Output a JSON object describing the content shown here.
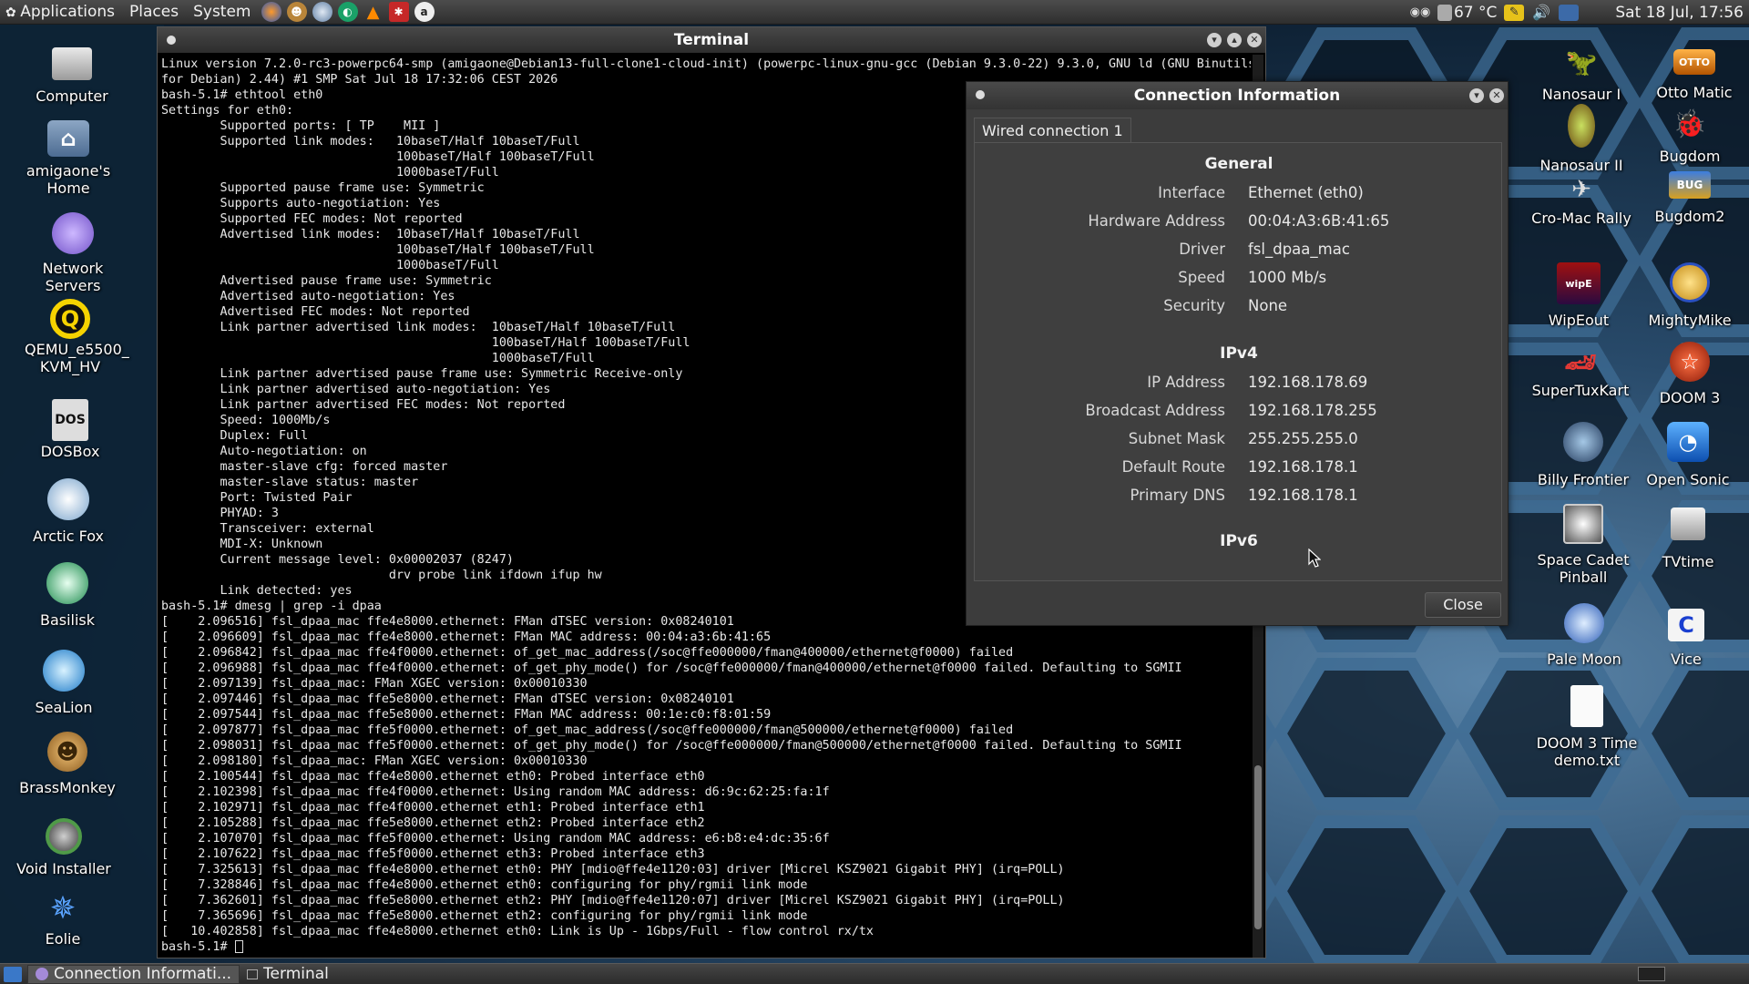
{
  "top_panel": {
    "menus": [
      "Applications",
      "Places",
      "System"
    ],
    "launchers": [
      "firefox-icon",
      "monkey-icon",
      "globe-icon",
      "app-icon",
      "vlc-icon",
      "tool-icon",
      "circle-a-icon"
    ],
    "temperature": "67 °C",
    "clock": "Sat 18 Jul, 17:56"
  },
  "desktop_left": [
    {
      "label": "Computer",
      "icon": "computer-icon"
    },
    {
      "label": "amigaone's Home",
      "icon": "home-folder-icon"
    },
    {
      "label": "Network Servers",
      "icon": "network-icon"
    },
    {
      "label": "QEMU_e5500_ KVM_HV",
      "icon": "qemu-icon"
    },
    {
      "label": "DOSBox",
      "icon": "dosbox-icon"
    },
    {
      "label": "Arctic Fox",
      "icon": "arctic-fox-icon"
    },
    {
      "label": "Basilisk",
      "icon": "basilisk-icon"
    },
    {
      "label": "SeaLion",
      "icon": "sealion-icon"
    },
    {
      "label": "BrassMonkey",
      "icon": "brassmonkey-icon"
    },
    {
      "label": "Void Installer",
      "icon": "void-icon"
    },
    {
      "label": "Eolie",
      "icon": "eolie-icon"
    }
  ],
  "desktop_right": [
    {
      "label": "Nanosaur I",
      "icon": "nanosaur-icon"
    },
    {
      "label": "Otto Matic",
      "icon": "otto-matic-icon"
    },
    {
      "label": "Nanosaur II",
      "icon": "nanosaur2-icon"
    },
    {
      "label": "Bugdom",
      "icon": "bugdom-icon"
    },
    {
      "label": "Cro-Mac Rally",
      "icon": "cromac-icon"
    },
    {
      "label": "Bugdom2",
      "icon": "bugdom2-icon"
    },
    {
      "label": "WipEout",
      "icon": "wipeout-icon"
    },
    {
      "label": "MightyMike",
      "icon": "mightymike-icon"
    },
    {
      "label": "SuperTuxKart",
      "icon": "supertuxkart-icon"
    },
    {
      "label": "DOOM 3",
      "icon": "doom3-icon"
    },
    {
      "label": "Billy Frontier",
      "icon": "billy-frontier-icon"
    },
    {
      "label": "Open Sonic",
      "icon": "open-sonic-icon"
    },
    {
      "label": "Space Cadet Pinball",
      "icon": "pinball-icon"
    },
    {
      "label": "TVtime",
      "icon": "tvtime-icon"
    },
    {
      "label": "Pale Moon",
      "icon": "palemoon-icon"
    },
    {
      "label": "Vice",
      "icon": "vice-icon"
    },
    {
      "label": "DOOM 3 Time demo.txt",
      "icon": "text-file-icon"
    }
  ],
  "terminal": {
    "title": "Terminal",
    "lines": [
      "Linux version 7.2.0-rc3-powerpc64-smp (amigaone@Debian13-full-clone1-cloud-init) (powerpc-linux-gnu-gcc (Debian 9.3.0-22) 9.3.0, GNU ld (GNU Binutils",
      "for Debian) 2.44) #1 SMP Sat Jul 18 17:32:06 CEST 2026",
      "bash-5.1# ethtool eth0",
      "Settings for eth0:",
      "        Supported ports: [ TP    MII ]",
      "        Supported link modes:   10baseT/Half 10baseT/Full",
      "                                100baseT/Half 100baseT/Full",
      "                                1000baseT/Full",
      "        Supported pause frame use: Symmetric",
      "        Supports auto-negotiation: Yes",
      "        Supported FEC modes: Not reported",
      "        Advertised link modes:  10baseT/Half 10baseT/Full",
      "                                100baseT/Half 100baseT/Full",
      "                                1000baseT/Full",
      "        Advertised pause frame use: Symmetric",
      "        Advertised auto-negotiation: Yes",
      "        Advertised FEC modes: Not reported",
      "        Link partner advertised link modes:  10baseT/Half 10baseT/Full",
      "                                             100baseT/Half 100baseT/Full",
      "                                             1000baseT/Full",
      "        Link partner advertised pause frame use: Symmetric Receive-only",
      "        Link partner advertised auto-negotiation: Yes",
      "        Link partner advertised FEC modes: Not reported",
      "        Speed: 1000Mb/s",
      "        Duplex: Full",
      "        Auto-negotiation: on",
      "        master-slave cfg: forced master",
      "        master-slave status: master",
      "        Port: Twisted Pair",
      "        PHYAD: 3",
      "        Transceiver: external",
      "        MDI-X: Unknown",
      "        Current message level: 0x00002037 (8247)",
      "                               drv probe link ifdown ifup hw",
      "        Link detected: yes",
      "bash-5.1# dmesg | grep -i dpaa",
      "[    2.096516] fsl_dpaa_mac ffe4e8000.ethernet: FMan dTSEC version: 0x08240101",
      "[    2.096609] fsl_dpaa_mac ffe4e8000.ethernet: FMan MAC address: 00:04:a3:6b:41:65",
      "[    2.096842] fsl_dpaa_mac ffe4f0000.ethernet: of_get_mac_address(/soc@ffe000000/fman@400000/ethernet@f0000) failed",
      "[    2.096988] fsl_dpaa_mac ffe4f0000.ethernet: of_get_phy_mode() for /soc@ffe000000/fman@400000/ethernet@f0000 failed. Defaulting to SGMII",
      "[    2.097139] fsl_dpaa_mac: FMan XGEC version: 0x00010330",
      "[    2.097446] fsl_dpaa_mac ffe5e8000.ethernet: FMan dTSEC version: 0x08240101",
      "[    2.097544] fsl_dpaa_mac ffe5e8000.ethernet: FMan MAC address: 00:1e:c0:f8:01:59",
      "[    2.097877] fsl_dpaa_mac ffe5f0000.ethernet: of_get_mac_address(/soc@ffe000000/fman@500000/ethernet@f0000) failed",
      "[    2.098031] fsl_dpaa_mac ffe5f0000.ethernet: of_get_phy_mode() for /soc@ffe000000/fman@500000/ethernet@f0000 failed. Defaulting to SGMII",
      "[    2.098180] fsl_dpaa_mac: FMan XGEC version: 0x00010330",
      "[    2.100544] fsl_dpaa_mac ffe4e8000.ethernet eth0: Probed interface eth0",
      "[    2.102398] fsl_dpaa_mac ffe4f0000.ethernet: Using random MAC address: d6:9c:62:25:fa:1f",
      "[    2.102971] fsl_dpaa_mac ffe4f0000.ethernet eth1: Probed interface eth1",
      "[    2.105288] fsl_dpaa_mac ffe5e8000.ethernet eth2: Probed interface eth2",
      "[    2.107070] fsl_dpaa_mac ffe5f0000.ethernet: Using random MAC address: e6:b8:e4:dc:35:6f",
      "[    2.107622] fsl_dpaa_mac ffe5f0000.ethernet eth3: Probed interface eth3",
      "[    7.325613] fsl_dpaa_mac ffe4e8000.ethernet eth0: PHY [mdio@ffe4e1120:03] driver [Micrel KSZ9021 Gigabit PHY] (irq=POLL)",
      "[    7.328846] fsl_dpaa_mac ffe4e8000.ethernet eth0: configuring for phy/rgmii link mode",
      "[    7.362601] fsl_dpaa_mac ffe5e8000.ethernet eth2: PHY [mdio@ffe4e1120:07] driver [Micrel KSZ9021 Gigabit PHY] (irq=POLL)",
      "[    7.365696] fsl_dpaa_mac ffe5e8000.ethernet eth2: configuring for phy/rgmii link mode",
      "[   10.402858] fsl_dpaa_mac ffe4e8000.ethernet eth0: Link is Up - 1Gbps/Full - flow control rx/tx"
    ],
    "prompt": "bash-5.1# "
  },
  "connection_dialog": {
    "title": "Connection Information",
    "tab_label": "Wired connection 1",
    "general_title": "General",
    "general": [
      {
        "key": "Interface",
        "value": "Ethernet (eth0)"
      },
      {
        "key": "Hardware Address",
        "value": "00:04:A3:6B:41:65"
      },
      {
        "key": "Driver",
        "value": "fsl_dpaa_mac"
      },
      {
        "key": "Speed",
        "value": "1000 Mb/s"
      },
      {
        "key": "Security",
        "value": "None"
      }
    ],
    "ipv4_title": "IPv4",
    "ipv4": [
      {
        "key": "IP Address",
        "value": "192.168.178.69"
      },
      {
        "key": "Broadcast Address",
        "value": "192.168.178.255"
      },
      {
        "key": "Subnet Mask",
        "value": "255.255.255.0"
      },
      {
        "key": "Default Route",
        "value": "192.168.178.1"
      },
      {
        "key": "Primary DNS",
        "value": "192.168.178.1"
      }
    ],
    "ipv6_title": "IPv6",
    "close_label": "Close"
  },
  "taskbar": {
    "tasks": [
      "Connection Informati...",
      "Terminal"
    ]
  }
}
